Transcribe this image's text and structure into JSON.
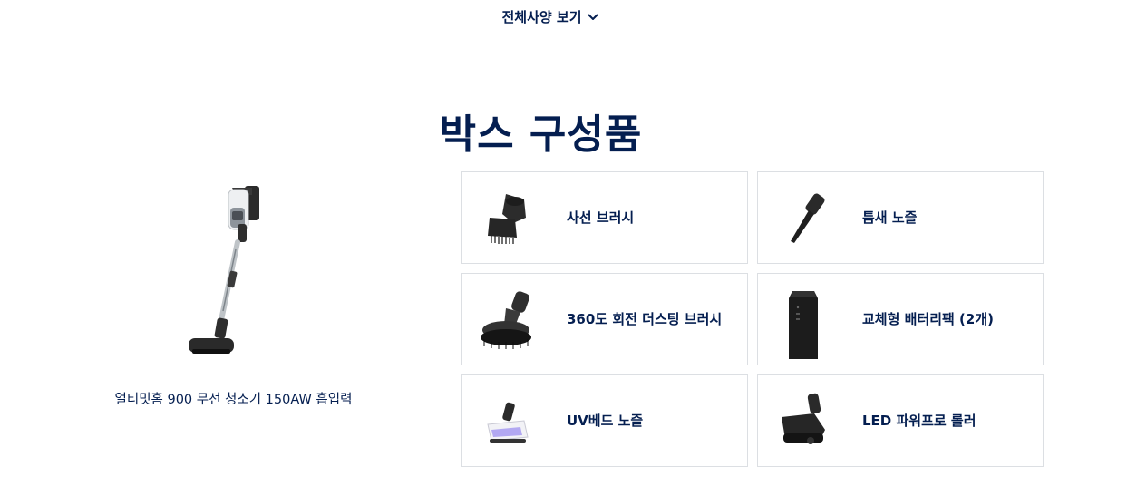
{
  "spec_toggle": {
    "label": "전체사양 보기",
    "icon": "chevron-down-icon"
  },
  "box_contents": {
    "title": "박스 구성품",
    "main_product": {
      "name": "얼티밋홈 900 무선 청소기 150AW 흡입력",
      "image": "stick-vacuum-image"
    },
    "items": [
      {
        "label": "사선 브러시",
        "image": "angled-brush-image"
      },
      {
        "label": "틈새 노즐",
        "image": "crevice-nozzle-image"
      },
      {
        "label": "360도 회전 더스팅 브러시",
        "image": "dusting-brush-image"
      },
      {
        "label": "교체형 배터리팩 (2개)",
        "image": "battery-pack-image"
      },
      {
        "label": "UV베드 노즐",
        "image": "uv-bed-nozzle-image"
      },
      {
        "label": "LED 파워프로 롤러",
        "image": "led-roller-nozzle-image"
      }
    ]
  },
  "colors": {
    "text": "#041e50",
    "border": "#dcdfe3"
  }
}
